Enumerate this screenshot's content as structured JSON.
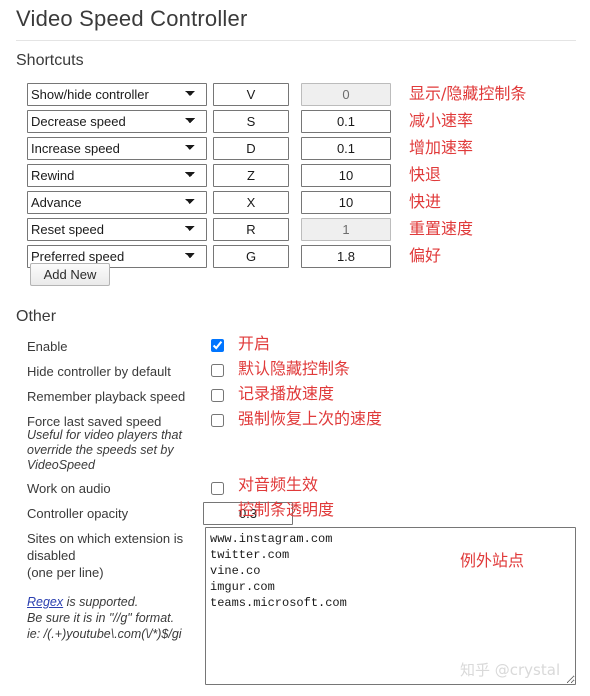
{
  "header": {
    "title": "Video Speed Controller"
  },
  "sections": {
    "shortcuts_heading": "Shortcuts",
    "other_heading": "Other"
  },
  "shortcuts": {
    "rows": [
      {
        "action": "Show/hide controller",
        "key": "V",
        "value": "0",
        "value_disabled": true,
        "note": "显示/隐藏控制条"
      },
      {
        "action": "Decrease speed",
        "key": "S",
        "value": "0.1",
        "value_disabled": false,
        "note": "减小速率"
      },
      {
        "action": "Increase speed",
        "key": "D",
        "value": "0.1",
        "value_disabled": false,
        "note": "增加速率"
      },
      {
        "action": "Rewind",
        "key": "Z",
        "value": "10",
        "value_disabled": false,
        "note": "快退"
      },
      {
        "action": "Advance",
        "key": "X",
        "value": "10",
        "value_disabled": false,
        "note": "快进"
      },
      {
        "action": "Reset speed",
        "key": "R",
        "value": "1",
        "value_disabled": true,
        "note": "重置速度"
      },
      {
        "action": "Preferred speed",
        "key": "G",
        "value": "1.8",
        "value_disabled": false,
        "note": "偏好"
      }
    ],
    "action_options": [
      "Show/hide controller",
      "Decrease speed",
      "Increase speed",
      "Rewind",
      "Advance",
      "Reset speed",
      "Preferred speed"
    ],
    "add_new_label": "Add New"
  },
  "other": {
    "enable": {
      "label": "Enable",
      "checked": true,
      "note": "开启"
    },
    "hide_controller_by_default": {
      "label": "Hide controller by default",
      "checked": false,
      "note": "默认隐藏控制条"
    },
    "remember_playback_speed": {
      "label": "Remember playback speed",
      "checked": false,
      "note": "记录播放速度"
    },
    "force_last_saved_speed": {
      "label": "Force last saved speed",
      "sublabel": "Useful for video players that override the speeds set by VideoSpeed",
      "checked": false,
      "note": "强制恢复上次的速度"
    },
    "work_on_audio": {
      "label": "Work on audio",
      "checked": false,
      "note": "对音频生效"
    },
    "controller_opacity": {
      "label": "Controller opacity",
      "value": "0.3",
      "note": "控制条透明度"
    }
  },
  "sites": {
    "label": "Sites on which extension is disabled\n(one per line)",
    "regex_link_text": "Regex",
    "regex_line1_rest": " is supported.",
    "regex_line2": "Be sure it is in \"//g\" format.",
    "regex_line3": "ie: /(.+)youtube\\.com(\\/*)$/gi",
    "textarea_value": "www.instagram.com\ntwitter.com\nvine.co\nimgur.com\nteams.microsoft.com",
    "note": "例外站点"
  },
  "watermark": {
    "text": "知乎 @crystal"
  },
  "colors": {
    "annotation_red": "#e03a3a",
    "link_blue": "#2a3fb0",
    "checkbox_accent": "#0a6ed1",
    "text": "#3a3a3a"
  }
}
